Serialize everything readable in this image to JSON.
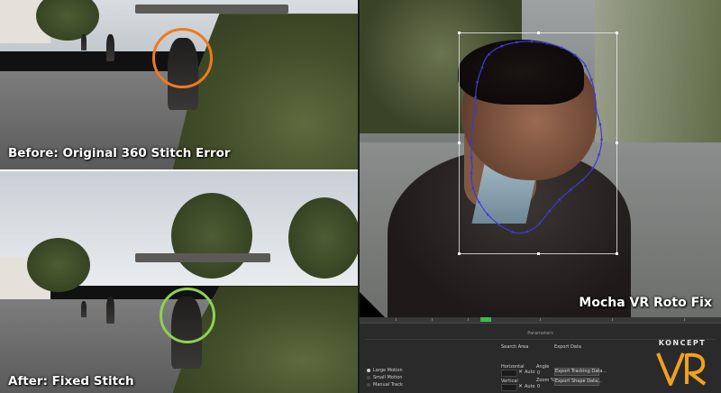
{
  "panels": {
    "before_caption": "Before: Original 360 Stitch Error",
    "after_caption": "After: Fixed Stitch",
    "mocha_caption": "Mocha VR Roto Fix"
  },
  "highlight_colors": {
    "before": "#f07a1e",
    "after": "#8fd14f",
    "spline": "#3b3bd0"
  },
  "parameters": {
    "title": "Parameters",
    "motion_options": [
      {
        "label": "Large Motion",
        "selected": true
      },
      {
        "label": "Small Motion",
        "selected": false
      },
      {
        "label": "Manual Track",
        "selected": false
      }
    ],
    "search_area": {
      "heading": "Search Area",
      "horizontal_label": "Horizontal",
      "vertical_label": "Vertical",
      "auto_label": "Auto",
      "angle_label": "Angle",
      "angle_value": "0",
      "zoom_label": "Zoom %",
      "zoom_value": "0"
    },
    "export": {
      "heading": "Export Data",
      "tracking_button": "Export Tracking Data...",
      "shape_button": "Export Shape Data..."
    }
  },
  "logo": {
    "wordmark": "KONCEPT",
    "mark": "VR",
    "accent": "#f0a020"
  }
}
